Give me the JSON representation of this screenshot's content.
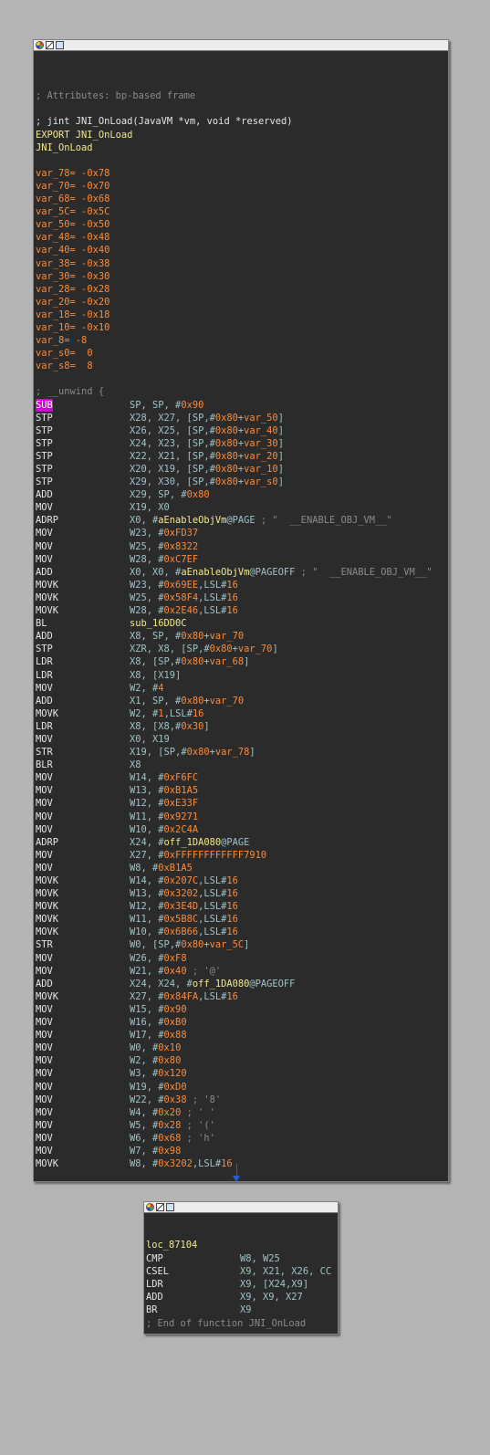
{
  "main_block": {
    "attributes_comment": "; Attributes: bp-based frame",
    "signature_comment": "; jint JNI_OnLoad(JavaVM *vm, void *reserved)",
    "export_line": "EXPORT JNI_OnLoad",
    "func_label": "JNI_OnLoad",
    "stack_vars": [
      {
        "name": "var_78",
        "value": "= -0x78"
      },
      {
        "name": "var_70",
        "value": "= -0x70"
      },
      {
        "name": "var_68",
        "value": "= -0x68"
      },
      {
        "name": "var_5C",
        "value": "= -0x5C"
      },
      {
        "name": "var_50",
        "value": "= -0x50"
      },
      {
        "name": "var_48",
        "value": "= -0x48"
      },
      {
        "name": "var_40",
        "value": "= -0x40"
      },
      {
        "name": "var_38",
        "value": "= -0x38"
      },
      {
        "name": "var_30",
        "value": "= -0x30"
      },
      {
        "name": "var_28",
        "value": "= -0x28"
      },
      {
        "name": "var_20",
        "value": "= -0x20"
      },
      {
        "name": "var_18",
        "value": "= -0x18"
      },
      {
        "name": "var_10",
        "value": "= -0x10"
      },
      {
        "name": "var_8",
        "value": "= -8"
      },
      {
        "name": "var_s0",
        "value": "=  0"
      },
      {
        "name": "var_s8",
        "value": "=  8"
      }
    ],
    "unwind_comment": "; __unwind {",
    "instructions": [
      {
        "mn": "SUB",
        "ops": "SP, SP, #0x90"
      },
      {
        "mn": "STP",
        "ops": "X28, X27, [SP,#0x80+var_50]"
      },
      {
        "mn": "STP",
        "ops": "X26, X25, [SP,#0x80+var_40]"
      },
      {
        "mn": "STP",
        "ops": "X24, X23, [SP,#0x80+var_30]"
      },
      {
        "mn": "STP",
        "ops": "X22, X21, [SP,#0x80+var_20]"
      },
      {
        "mn": "STP",
        "ops": "X20, X19, [SP,#0x80+var_10]"
      },
      {
        "mn": "STP",
        "ops": "X29, X30, [SP,#0x80+var_s0]"
      },
      {
        "mn": "ADD",
        "ops": "X29, SP, #0x80"
      },
      {
        "mn": "MOV",
        "ops": "X19, X0"
      },
      {
        "mn": "ADRP",
        "ops": "X0, #aEnableObjVm@PAGE ; \"  __ENABLE_OBJ_VM__\""
      },
      {
        "mn": "MOV",
        "ops": "W23, #0xFD37"
      },
      {
        "mn": "MOV",
        "ops": "W25, #0x8322"
      },
      {
        "mn": "MOV",
        "ops": "W28, #0xC7EF"
      },
      {
        "mn": "ADD",
        "ops": "X0, X0, #aEnableObjVm@PAGEOFF ; \"  __ENABLE_OBJ_VM__\""
      },
      {
        "mn": "MOVK",
        "ops": "W23, #0x69EE,LSL#16"
      },
      {
        "mn": "MOVK",
        "ops": "W25, #0x58F4,LSL#16"
      },
      {
        "mn": "MOVK",
        "ops": "W28, #0x2E46,LSL#16"
      },
      {
        "mn": "BL",
        "ops": "sub_16DD0C"
      },
      {
        "mn": "ADD",
        "ops": "X8, SP, #0x80+var_70"
      },
      {
        "mn": "STP",
        "ops": "XZR, X8, [SP,#0x80+var_70]"
      },
      {
        "mn": "LDR",
        "ops": "X8, [SP,#0x80+var_68]"
      },
      {
        "mn": "LDR",
        "ops": "X8, [X19]"
      },
      {
        "mn": "MOV",
        "ops": "W2, #4"
      },
      {
        "mn": "ADD",
        "ops": "X1, SP, #0x80+var_70"
      },
      {
        "mn": "MOVK",
        "ops": "W2, #1,LSL#16"
      },
      {
        "mn": "LDR",
        "ops": "X8, [X8,#0x30]"
      },
      {
        "mn": "MOV",
        "ops": "X0, X19"
      },
      {
        "mn": "STR",
        "ops": "X19, [SP,#0x80+var_78]"
      },
      {
        "mn": "BLR",
        "ops": "X8"
      },
      {
        "mn": "MOV",
        "ops": "W14, #0xF6FC"
      },
      {
        "mn": "MOV",
        "ops": "W13, #0xB1A5"
      },
      {
        "mn": "MOV",
        "ops": "W12, #0xE33F"
      },
      {
        "mn": "MOV",
        "ops": "W11, #0x9271"
      },
      {
        "mn": "MOV",
        "ops": "W10, #0x2C4A"
      },
      {
        "mn": "ADRP",
        "ops": "X24, #off_1DA080@PAGE"
      },
      {
        "mn": "MOV",
        "ops": "X27, #0xFFFFFFFFFFFF7910"
      },
      {
        "mn": "MOV",
        "ops": "W8, #0xB1A5"
      },
      {
        "mn": "MOVK",
        "ops": "W14, #0x207C,LSL#16"
      },
      {
        "mn": "MOVK",
        "ops": "W13, #0x3202,LSL#16"
      },
      {
        "mn": "MOVK",
        "ops": "W12, #0x3E4D,LSL#16"
      },
      {
        "mn": "MOVK",
        "ops": "W11, #0x5B8C,LSL#16"
      },
      {
        "mn": "MOVK",
        "ops": "W10, #0x6B66,LSL#16"
      },
      {
        "mn": "STR",
        "ops": "W0, [SP,#0x80+var_5C]"
      },
      {
        "mn": "MOV",
        "ops": "W26, #0xF8"
      },
      {
        "mn": "MOV",
        "ops": "W21, #0x40 ; '@'"
      },
      {
        "mn": "ADD",
        "ops": "X24, X24, #off_1DA080@PAGEOFF"
      },
      {
        "mn": "MOVK",
        "ops": "X27, #0x84FA,LSL#16"
      },
      {
        "mn": "MOV",
        "ops": "W15, #0x90"
      },
      {
        "mn": "MOV",
        "ops": "W16, #0xB0"
      },
      {
        "mn": "MOV",
        "ops": "W17, #0x88"
      },
      {
        "mn": "MOV",
        "ops": "W0, #0x10"
      },
      {
        "mn": "MOV",
        "ops": "W2, #0x80"
      },
      {
        "mn": "MOV",
        "ops": "W3, #0x120"
      },
      {
        "mn": "MOV",
        "ops": "W19, #0xD0"
      },
      {
        "mn": "MOV",
        "ops": "W22, #0x38 ; '8'"
      },
      {
        "mn": "MOV",
        "ops": "W4, #0x20 ; ' '"
      },
      {
        "mn": "MOV",
        "ops": "W5, #0x28 ; '('"
      },
      {
        "mn": "MOV",
        "ops": "W6, #0x68 ; 'h'"
      },
      {
        "mn": "MOV",
        "ops": "W7, #0x98"
      },
      {
        "mn": "MOVK",
        "ops": "W8, #0x3202,LSL#16"
      }
    ]
  },
  "tail_block": {
    "label": "loc_87104",
    "instructions": [
      {
        "mn": "CMP",
        "ops": "W8, W25"
      },
      {
        "mn": "CSEL",
        "ops": "X9, X21, X26, CC"
      },
      {
        "mn": "LDR",
        "ops": "X9, [X24,X9]"
      },
      {
        "mn": "ADD",
        "ops": "X9, X9, X27"
      },
      {
        "mn": "BR",
        "ops": "X9"
      }
    ],
    "end_comment": "; End of function JNI_OnLoad"
  },
  "colors": {
    "node_bg": "#2b2b2b",
    "canvas_bg": "#b4b4b4",
    "number": "#ff8a35",
    "symbol": "#f2e88c",
    "register": "#9ec4c8",
    "comment": "#8a8a8a",
    "highlight": "#d400d4",
    "edge": "#2a5bd7"
  }
}
